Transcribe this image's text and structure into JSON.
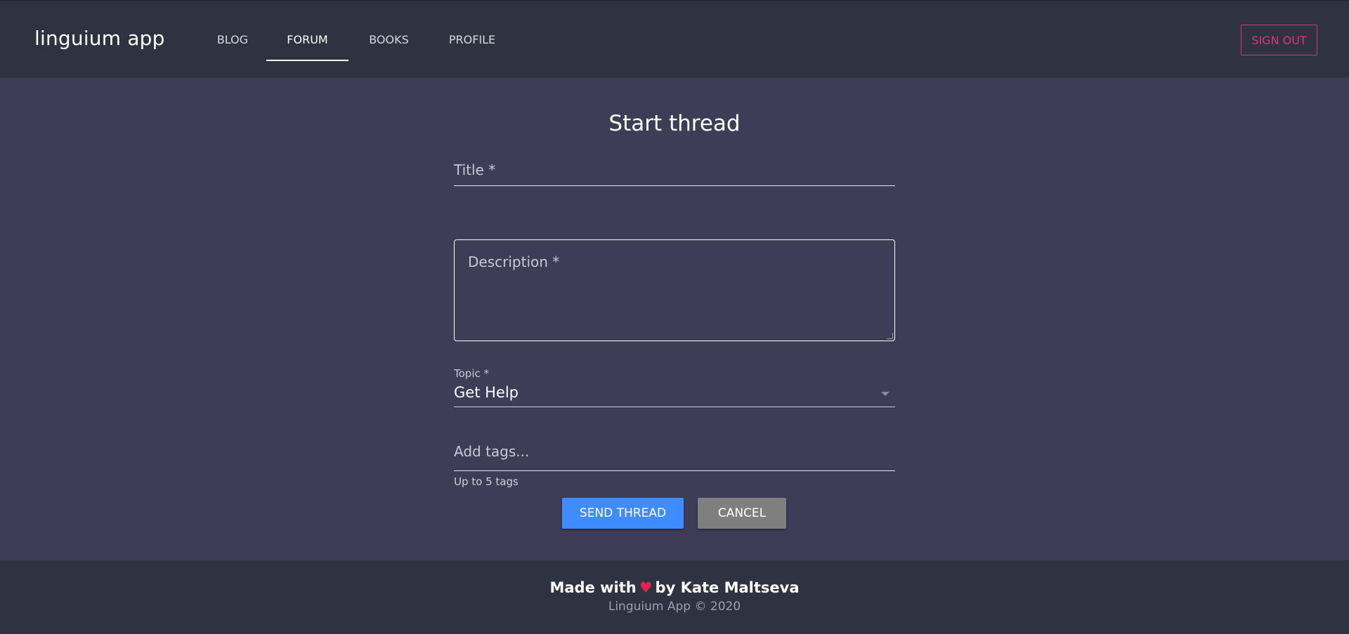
{
  "header": {
    "brand": "linguium app",
    "nav": [
      {
        "label": "BLOG",
        "active": false
      },
      {
        "label": "FORUM",
        "active": true
      },
      {
        "label": "BOOKS",
        "active": false
      },
      {
        "label": "PROFILE",
        "active": false
      }
    ],
    "sign_out_label": "SIGN OUT"
  },
  "form": {
    "heading": "Start thread",
    "title_placeholder": "Title *",
    "description_placeholder": "Description *",
    "topic_label": "Topic *",
    "topic_value": "Get Help",
    "tags_placeholder": "Add tags...",
    "tags_hint": "Up to 5 tags",
    "send_label": "SEND THREAD",
    "cancel_label": "CANCEL"
  },
  "footer": {
    "made_with_prefix": "Made with",
    "heart": "♥",
    "made_with_suffix": "by Kate Maltseva",
    "copyright": "Linguium App © 2020"
  },
  "colors": {
    "header_bg": "#2f3240",
    "page_bg": "#3f3c58",
    "accent_pink": "#d6377f",
    "send_blue": "#3f8cff",
    "cancel_grey": "#7f7f7f",
    "heart_red": "#e32255"
  }
}
